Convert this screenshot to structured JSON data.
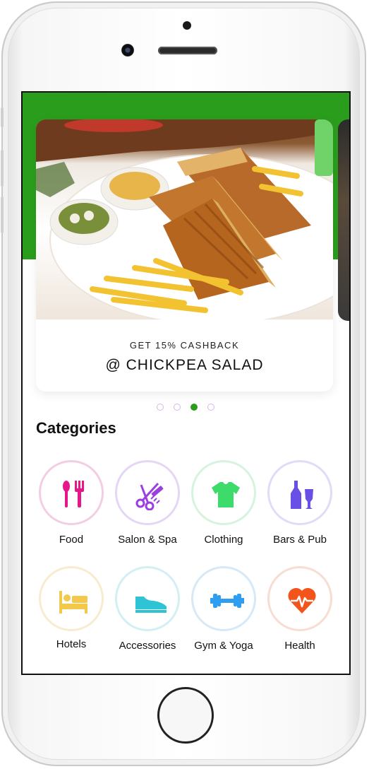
{
  "banner": {
    "subtitle": "GET 15% CASHBACK",
    "title": "@ CHICKPEA SALAD",
    "image_icon": "sandwich-photo"
  },
  "carousel": {
    "page_count": 4,
    "active_index": 2
  },
  "categories": {
    "heading": "Categories",
    "items": [
      {
        "label": "Food",
        "icon": "cutlery-icon",
        "color": "#e6178a",
        "ring": "#f3cde3"
      },
      {
        "label": "Salon & Spa",
        "icon": "scissors-comb-icon",
        "color": "#9a3fe0",
        "ring": "#e6d6f5"
      },
      {
        "label": "Clothing",
        "icon": "tshirt-icon",
        "color": "#3ddc6a",
        "ring": "#d6f3de"
      },
      {
        "label": "Bars & Pub",
        "icon": "bottle-glass-icon",
        "color": "#6a4fe6",
        "ring": "#e0dcf7"
      },
      {
        "label": "Hotels",
        "icon": "bed-icon",
        "color": "#f2c94c",
        "ring": "#f7ecd0"
      },
      {
        "label": "Accessories",
        "icon": "shoe-icon",
        "color": "#2ec4d6",
        "ring": "#d2eff3"
      },
      {
        "label": "Gym & Yoga",
        "icon": "dumbbell-icon",
        "color": "#2e9ef0",
        "ring": "#d5e9f8"
      },
      {
        "label": "Health",
        "icon": "heart-pulse-icon",
        "color": "#f2541b",
        "ring": "#f7ddd2"
      }
    ]
  },
  "colors": {
    "brand_green": "#2a9e1c"
  }
}
